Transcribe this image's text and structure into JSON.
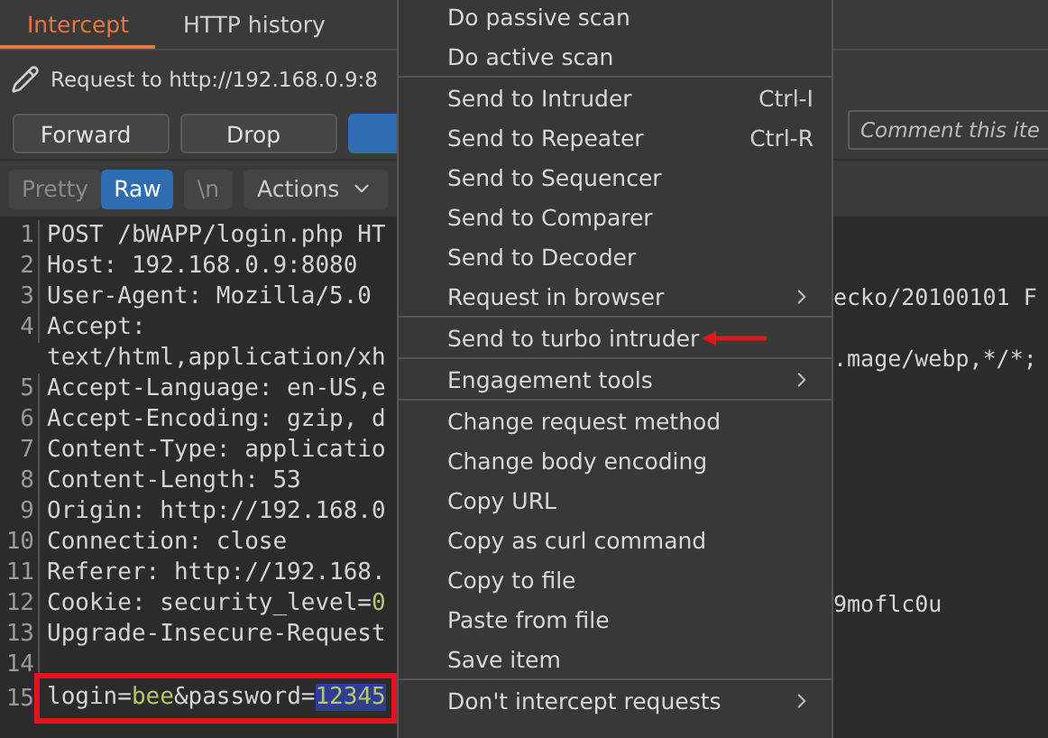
{
  "tabs": [
    {
      "label": "Intercept",
      "selected": true
    },
    {
      "label": "HTTP history",
      "selected": false
    }
  ],
  "request_label": "Request to http://192.168.0.9:8",
  "buttons": [
    {
      "label": "Forward",
      "kind": "plain"
    },
    {
      "label": "Drop",
      "kind": "plain"
    },
    {
      "kind": "primary"
    }
  ],
  "comment_field": {
    "placeholder": "Comment this ite"
  },
  "view_tabs": [
    {
      "label": "Pretty",
      "selected": false
    },
    {
      "label": "Raw",
      "selected": true
    },
    {
      "label": "\\n",
      "selected": false
    }
  ],
  "actions_label": "Actions",
  "editor_lines": [
    {
      "number": "1",
      "left": [
        {
          "text": "POST /bWAPP/login.php HT",
          "kind": "plain"
        }
      ]
    },
    {
      "number": "2",
      "left": [
        {
          "text": "Host: 192.168.0.9:8080",
          "kind": "plain"
        }
      ]
    },
    {
      "number": "3",
      "left": [
        {
          "text": "User-Agent: Mozilla/5.0",
          "kind": "plain"
        }
      ],
      "right": "ecko/20100101 F"
    },
    {
      "number": "4",
      "left": [
        {
          "text": "Accept:",
          "kind": "plain"
        }
      ]
    },
    {
      "left": [
        {
          "text": "text/html,application/xh",
          "kind": "plain"
        }
      ],
      "right": ".mage/webp,*/*;"
    },
    {
      "number": "5",
      "left": [
        {
          "text": "Accept-Language: en-US,e",
          "kind": "plain"
        }
      ]
    },
    {
      "number": "6",
      "left": [
        {
          "text": "Accept-Encoding: gzip, d",
          "kind": "plain"
        }
      ]
    },
    {
      "number": "7",
      "left": [
        {
          "text": "Content-Type: applicatio",
          "kind": "plain"
        }
      ]
    },
    {
      "number": "8",
      "left": [
        {
          "text": "Content-Length: 53",
          "kind": "plain"
        }
      ]
    },
    {
      "number": "9",
      "left": [
        {
          "text": "Origin: http://192.168.0",
          "kind": "plain"
        }
      ]
    },
    {
      "number": "10",
      "left": [
        {
          "text": "Connection: close",
          "kind": "plain"
        }
      ]
    },
    {
      "number": "11",
      "left": [
        {
          "text": "Referer: http://192.168.",
          "kind": "plain"
        }
      ]
    },
    {
      "number": "12",
      "left": [
        {
          "text": "Cookie: security_level=",
          "kind": "plain"
        },
        {
          "text": "0",
          "kind": "value"
        }
      ],
      "right": "9moflc0u"
    },
    {
      "number": "13",
      "left": [
        {
          "text": "Upgrade-Insecure-Request",
          "kind": "plain"
        }
      ]
    },
    {
      "number": "14"
    },
    {
      "number": "15",
      "boxed": true,
      "left": [
        {
          "text": "login=",
          "kind": "plain"
        },
        {
          "text": "bee",
          "kind": "value"
        },
        {
          "text": "&password=",
          "kind": "plain"
        },
        {
          "text": "12345",
          "kind": "selected"
        }
      ]
    }
  ],
  "context_menu": {
    "groups": [
      [
        {
          "label": "Do passive scan"
        },
        {
          "label": "Do active scan"
        }
      ],
      [
        {
          "label": "Send to Intruder",
          "shortcut": "Ctrl-I"
        },
        {
          "label": "Send to Repeater",
          "shortcut": "Ctrl-R"
        },
        {
          "label": "Send to Sequencer"
        },
        {
          "label": "Send to Comparer"
        },
        {
          "label": "Send to Decoder"
        },
        {
          "label": "Request in browser",
          "submenu": true
        }
      ],
      [
        {
          "label": "Send to turbo intruder",
          "pointed": true
        }
      ],
      [
        {
          "label": "Engagement tools",
          "submenu": true
        }
      ],
      [
        {
          "label": "Change request method"
        },
        {
          "label": "Change body encoding"
        },
        {
          "label": "Copy URL"
        },
        {
          "label": "Copy as curl command"
        },
        {
          "label": "Copy to file"
        },
        {
          "label": "Paste from file"
        },
        {
          "label": "Save item"
        }
      ],
      [
        {
          "label": "Don't intercept requests",
          "submenu": true
        }
      ]
    ]
  }
}
